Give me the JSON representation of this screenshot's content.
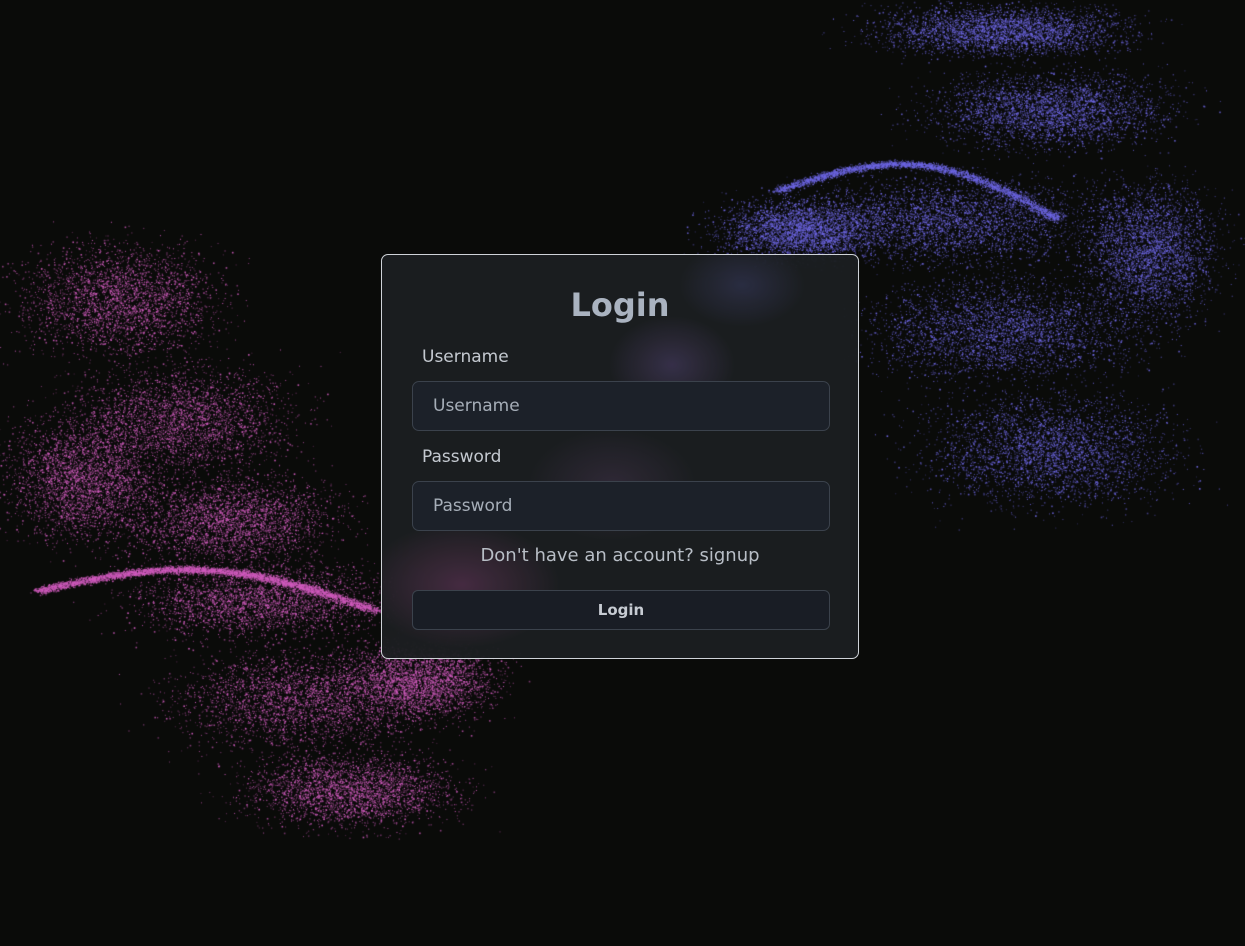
{
  "page": {
    "background": "#0a0b09"
  },
  "login_form": {
    "title": "Login",
    "username": {
      "label": "Username",
      "value": "",
      "placeholder": "Username"
    },
    "password": {
      "label": "Password",
      "value": "",
      "placeholder": "Password"
    },
    "signup_prompt": "Don't have an account?",
    "signup_link": "signup",
    "submit_label": "Login"
  },
  "colors": {
    "particles_left": "#d25cbf",
    "particles_right": "#6f68e6",
    "card_border": "#cfd3d8",
    "input_bg": "#1c2129",
    "title": "#aab3c0"
  }
}
